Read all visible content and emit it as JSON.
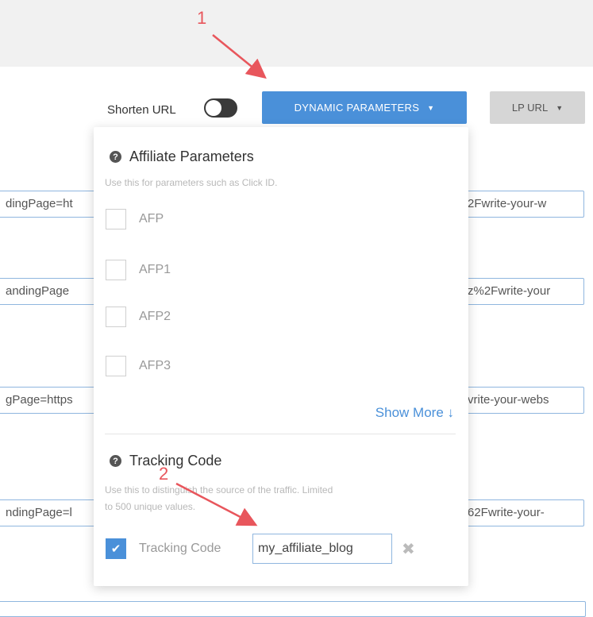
{
  "toolbar": {
    "shorten_url_label": "Shorten URL",
    "dynamic_parameters_label": "DYNAMIC PARAMETERS",
    "lp_url_label": "LP URL"
  },
  "background_fields": [
    {
      "left": "dingPage=ht",
      "right": "2Fwrite-your-w"
    },
    {
      "left": "andingPage",
      "right": "z%2Fwrite-your"
    },
    {
      "left": "gPage=https",
      "right": "vrite-your-webs"
    },
    {
      "left": "ndingPage=l",
      "right": "62Fwrite-your-"
    }
  ],
  "affiliate": {
    "title": "Affiliate Parameters",
    "hint": "Use this for parameters such as Click ID.",
    "options": [
      "AFP",
      "AFP1",
      "AFP2",
      "AFP3"
    ],
    "show_more": "Show More ↓"
  },
  "tracking": {
    "title": "Tracking Code",
    "hint_line1": "Use this to distinguish the source of the traffic. Limited",
    "hint_line2": "to 500 unique values.",
    "checkbox_label": "Tracking Code",
    "input_value": "my_affiliate_blog"
  },
  "annotations": [
    "1",
    "2"
  ],
  "colors": {
    "accent": "#4a90d9",
    "annotation": "#e8565c"
  }
}
